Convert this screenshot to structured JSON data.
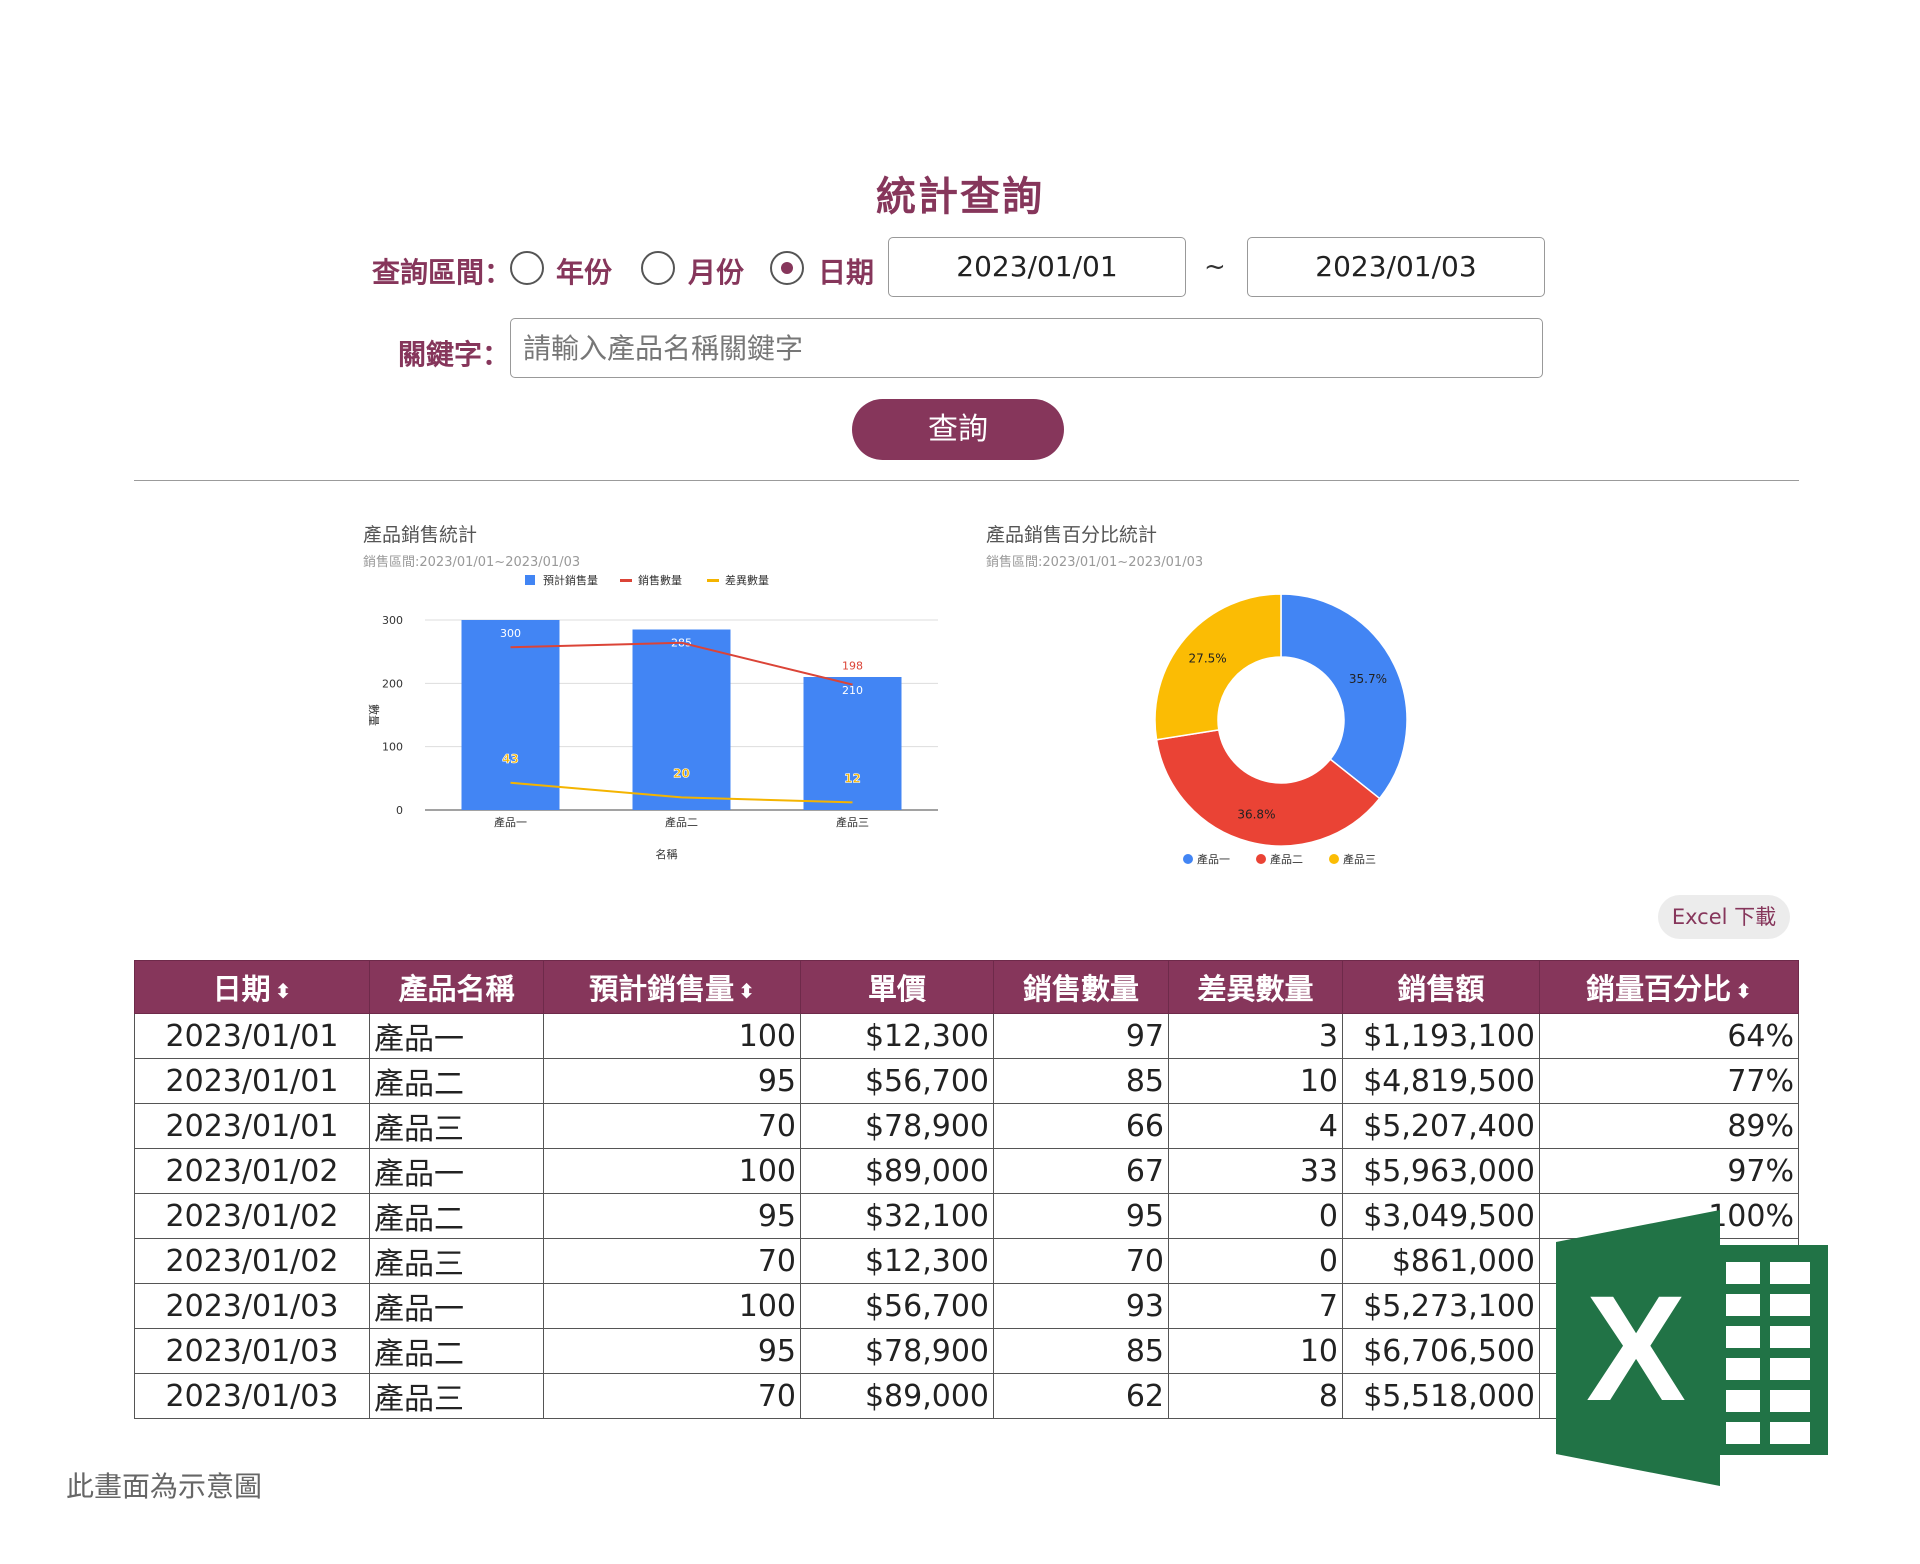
{
  "title": "統計查詢",
  "query": {
    "range_label": "查詢區間：",
    "options": [
      {
        "label": "年份",
        "selected": false
      },
      {
        "label": "月份",
        "selected": false
      },
      {
        "label": "日期",
        "selected": true
      }
    ],
    "start_date": "2023/01/01",
    "tilde": "~",
    "end_date": "2023/01/03",
    "keyword_label": "關鍵字：",
    "keyword_placeholder": "請輸入產品名稱關鍵字",
    "keyword_value": "",
    "submit_label": "查詢"
  },
  "bar_chart": {
    "title": "產品銷售統計",
    "subtitle": "銷售區間:2023/01/01~2023/01/03"
  },
  "pie_chart": {
    "title": "產品銷售百分比統計",
    "subtitle": "銷售區間:2023/01/01~2023/01/03"
  },
  "chart_data": [
    {
      "type": "bar",
      "title": "產品銷售統計",
      "subtitle": "銷售區間:2023/01/01~2023/01/03",
      "categories": [
        "產品一",
        "產品二",
        "產品三"
      ],
      "series": [
        {
          "name": "預計銷售量",
          "type": "bar",
          "color": "#4285f4",
          "values": [
            300,
            285,
            210
          ]
        },
        {
          "name": "銷售數量",
          "type": "line",
          "color": "#db4437",
          "values": [
            257,
            264,
            198
          ]
        },
        {
          "name": "差異數量",
          "type": "line",
          "color": "#f4b400",
          "values": [
            43,
            20,
            12
          ]
        }
      ],
      "data_labels": {
        "預計銷售量": [
          "300",
          "285",
          "210"
        ],
        "銷售數量": [
          "",
          "",
          "198"
        ],
        "差異數量": [
          "43",
          "20",
          "12"
        ]
      },
      "xlabel": "名稱",
      "ylabel": "數量",
      "ylim": [
        0,
        300
      ],
      "yticks": [
        0,
        100,
        200,
        300
      ],
      "grid": true,
      "legend": "top"
    },
    {
      "type": "pie",
      "donut": true,
      "title": "產品銷售百分比統計",
      "subtitle": "銷售區間:2023/01/01~2023/01/03",
      "categories": [
        "產品一",
        "產品二",
        "產品三"
      ],
      "values": [
        35.7,
        36.8,
        27.5
      ],
      "labels": [
        "35.7%",
        "36.8%",
        "27.5%"
      ],
      "colors": [
        "#4285f4",
        "#ea4335",
        "#fbbc04"
      ],
      "legend": "bottom"
    }
  ],
  "excel_button": "Excel 下載",
  "table": {
    "headers": [
      {
        "label": "日期",
        "sortable": true
      },
      {
        "label": "產品名稱",
        "sortable": false
      },
      {
        "label": "預計銷售量",
        "sortable": true
      },
      {
        "label": "單價",
        "sortable": false
      },
      {
        "label": "銷售數量",
        "sortable": false
      },
      {
        "label": "差異數量",
        "sortable": false
      },
      {
        "label": "銷售額",
        "sortable": false
      },
      {
        "label": "銷量百分比",
        "sortable": true
      }
    ],
    "sort_icon": "⬍",
    "rows": [
      [
        "2023/01/01",
        "產品一",
        "100",
        "$12,300",
        "97",
        "3",
        "$1,193,100",
        "64%"
      ],
      [
        "2023/01/01",
        "產品二",
        "95",
        "$56,700",
        "85",
        "10",
        "$4,819,500",
        "77%"
      ],
      [
        "2023/01/01",
        "產品三",
        "70",
        "$78,900",
        "66",
        "4",
        "$5,207,400",
        "89%"
      ],
      [
        "2023/01/02",
        "產品一",
        "100",
        "$89,000",
        "67",
        "33",
        "$5,963,000",
        "97%"
      ],
      [
        "2023/01/02",
        "產品二",
        "95",
        "$32,100",
        "95",
        "0",
        "$3,049,500",
        "100%"
      ],
      [
        "2023/01/02",
        "產品三",
        "70",
        "$12,300",
        "70",
        "0",
        "$861,000",
        ""
      ],
      [
        "2023/01/03",
        "產品一",
        "100",
        "$56,700",
        "93",
        "7",
        "$5,273,100",
        ""
      ],
      [
        "2023/01/03",
        "產品二",
        "95",
        "$78,900",
        "85",
        "10",
        "$6,706,500",
        ""
      ],
      [
        "2023/01/03",
        "產品三",
        "70",
        "$89,000",
        "62",
        "8",
        "$5,518,000",
        ""
      ]
    ]
  },
  "excel_logo": {
    "icon": "excel-logo-icon",
    "letter": "X",
    "color": "#217346"
  },
  "footnote": "此畫面為示意圖"
}
